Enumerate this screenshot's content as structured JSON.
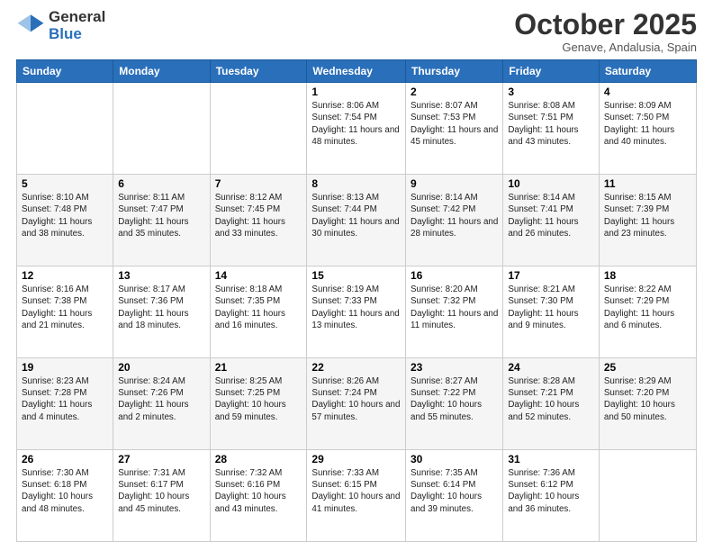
{
  "logo": {
    "general": "General",
    "blue": "Blue"
  },
  "title": "October 2025",
  "location": "Genave, Andalusia, Spain",
  "days_of_week": [
    "Sunday",
    "Monday",
    "Tuesday",
    "Wednesday",
    "Thursday",
    "Friday",
    "Saturday"
  ],
  "weeks": [
    [
      {
        "num": "",
        "info": ""
      },
      {
        "num": "",
        "info": ""
      },
      {
        "num": "",
        "info": ""
      },
      {
        "num": "1",
        "info": "Sunrise: 8:06 AM\nSunset: 7:54 PM\nDaylight: 11 hours and 48 minutes."
      },
      {
        "num": "2",
        "info": "Sunrise: 8:07 AM\nSunset: 7:53 PM\nDaylight: 11 hours and 45 minutes."
      },
      {
        "num": "3",
        "info": "Sunrise: 8:08 AM\nSunset: 7:51 PM\nDaylight: 11 hours and 43 minutes."
      },
      {
        "num": "4",
        "info": "Sunrise: 8:09 AM\nSunset: 7:50 PM\nDaylight: 11 hours and 40 minutes."
      }
    ],
    [
      {
        "num": "5",
        "info": "Sunrise: 8:10 AM\nSunset: 7:48 PM\nDaylight: 11 hours and 38 minutes."
      },
      {
        "num": "6",
        "info": "Sunrise: 8:11 AM\nSunset: 7:47 PM\nDaylight: 11 hours and 35 minutes."
      },
      {
        "num": "7",
        "info": "Sunrise: 8:12 AM\nSunset: 7:45 PM\nDaylight: 11 hours and 33 minutes."
      },
      {
        "num": "8",
        "info": "Sunrise: 8:13 AM\nSunset: 7:44 PM\nDaylight: 11 hours and 30 minutes."
      },
      {
        "num": "9",
        "info": "Sunrise: 8:14 AM\nSunset: 7:42 PM\nDaylight: 11 hours and 28 minutes."
      },
      {
        "num": "10",
        "info": "Sunrise: 8:14 AM\nSunset: 7:41 PM\nDaylight: 11 hours and 26 minutes."
      },
      {
        "num": "11",
        "info": "Sunrise: 8:15 AM\nSunset: 7:39 PM\nDaylight: 11 hours and 23 minutes."
      }
    ],
    [
      {
        "num": "12",
        "info": "Sunrise: 8:16 AM\nSunset: 7:38 PM\nDaylight: 11 hours and 21 minutes."
      },
      {
        "num": "13",
        "info": "Sunrise: 8:17 AM\nSunset: 7:36 PM\nDaylight: 11 hours and 18 minutes."
      },
      {
        "num": "14",
        "info": "Sunrise: 8:18 AM\nSunset: 7:35 PM\nDaylight: 11 hours and 16 minutes."
      },
      {
        "num": "15",
        "info": "Sunrise: 8:19 AM\nSunset: 7:33 PM\nDaylight: 11 hours and 13 minutes."
      },
      {
        "num": "16",
        "info": "Sunrise: 8:20 AM\nSunset: 7:32 PM\nDaylight: 11 hours and 11 minutes."
      },
      {
        "num": "17",
        "info": "Sunrise: 8:21 AM\nSunset: 7:30 PM\nDaylight: 11 hours and 9 minutes."
      },
      {
        "num": "18",
        "info": "Sunrise: 8:22 AM\nSunset: 7:29 PM\nDaylight: 11 hours and 6 minutes."
      }
    ],
    [
      {
        "num": "19",
        "info": "Sunrise: 8:23 AM\nSunset: 7:28 PM\nDaylight: 11 hours and 4 minutes."
      },
      {
        "num": "20",
        "info": "Sunrise: 8:24 AM\nSunset: 7:26 PM\nDaylight: 11 hours and 2 minutes."
      },
      {
        "num": "21",
        "info": "Sunrise: 8:25 AM\nSunset: 7:25 PM\nDaylight: 10 hours and 59 minutes."
      },
      {
        "num": "22",
        "info": "Sunrise: 8:26 AM\nSunset: 7:24 PM\nDaylight: 10 hours and 57 minutes."
      },
      {
        "num": "23",
        "info": "Sunrise: 8:27 AM\nSunset: 7:22 PM\nDaylight: 10 hours and 55 minutes."
      },
      {
        "num": "24",
        "info": "Sunrise: 8:28 AM\nSunset: 7:21 PM\nDaylight: 10 hours and 52 minutes."
      },
      {
        "num": "25",
        "info": "Sunrise: 8:29 AM\nSunset: 7:20 PM\nDaylight: 10 hours and 50 minutes."
      }
    ],
    [
      {
        "num": "26",
        "info": "Sunrise: 7:30 AM\nSunset: 6:18 PM\nDaylight: 10 hours and 48 minutes."
      },
      {
        "num": "27",
        "info": "Sunrise: 7:31 AM\nSunset: 6:17 PM\nDaylight: 10 hours and 45 minutes."
      },
      {
        "num": "28",
        "info": "Sunrise: 7:32 AM\nSunset: 6:16 PM\nDaylight: 10 hours and 43 minutes."
      },
      {
        "num": "29",
        "info": "Sunrise: 7:33 AM\nSunset: 6:15 PM\nDaylight: 10 hours and 41 minutes."
      },
      {
        "num": "30",
        "info": "Sunrise: 7:35 AM\nSunset: 6:14 PM\nDaylight: 10 hours and 39 minutes."
      },
      {
        "num": "31",
        "info": "Sunrise: 7:36 AM\nSunset: 6:12 PM\nDaylight: 10 hours and 36 minutes."
      },
      {
        "num": "",
        "info": ""
      }
    ]
  ]
}
